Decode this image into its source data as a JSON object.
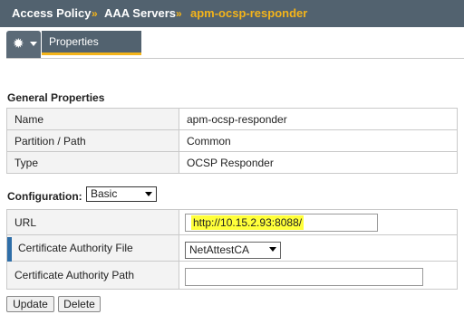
{
  "breadcrumb": {
    "part1": "Access Policy",
    "separator": "»",
    "part2": "AAA Servers",
    "current": "apm-ocsp-responder"
  },
  "tabs": {
    "gear_icon": "gear-icon",
    "properties": "Properties"
  },
  "general": {
    "title": "General Properties",
    "rows": [
      {
        "label": "Name",
        "value": "apm-ocsp-responder"
      },
      {
        "label": "Partition / Path",
        "value": "Common"
      },
      {
        "label": "Type",
        "value": "OCSP Responder"
      }
    ]
  },
  "configuration": {
    "label": "Configuration:",
    "mode": "Basic",
    "url_label": "URL",
    "url_value": "http://10.15.2.93:8088/",
    "ca_file_label": "Certificate Authority File",
    "ca_file_value": "NetAttestCA",
    "ca_path_label": "Certificate Authority Path",
    "ca_path_value": ""
  },
  "buttons": {
    "update": "Update",
    "delete": "Delete"
  },
  "colors": {
    "header_bg": "#52626f",
    "accent": "#f4b41a",
    "highlight": "#ffff3a",
    "required_bar": "#2e6ea8"
  }
}
